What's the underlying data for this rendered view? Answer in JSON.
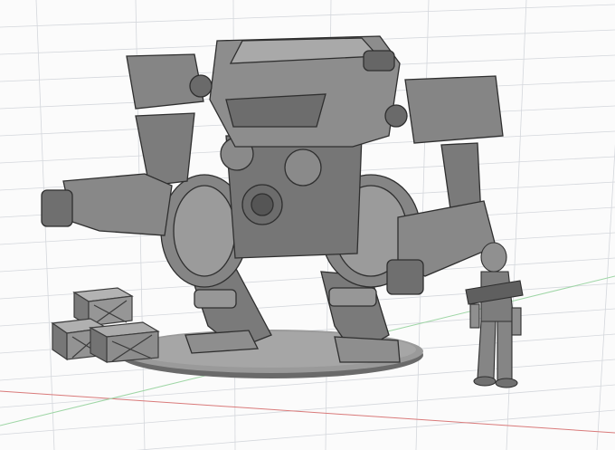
{
  "viewport": {
    "background": "#fbfbfb",
    "grid_color": "#c9cdd3",
    "x_axis_color": "#d65a5a",
    "y_axis_color": "#7fc98a"
  },
  "scene": {
    "model_color": "#7d7d7d",
    "model_shadow": "#4e4e4e",
    "model_light": "#a9a9a9",
    "base_color": "#8e8e8e",
    "objects": [
      {
        "name": "mech-robot",
        "icon": "mech-model"
      },
      {
        "name": "soldier-figure",
        "icon": "humanoid-model"
      },
      {
        "name": "supply-crates",
        "icon": "crate-model"
      }
    ]
  }
}
